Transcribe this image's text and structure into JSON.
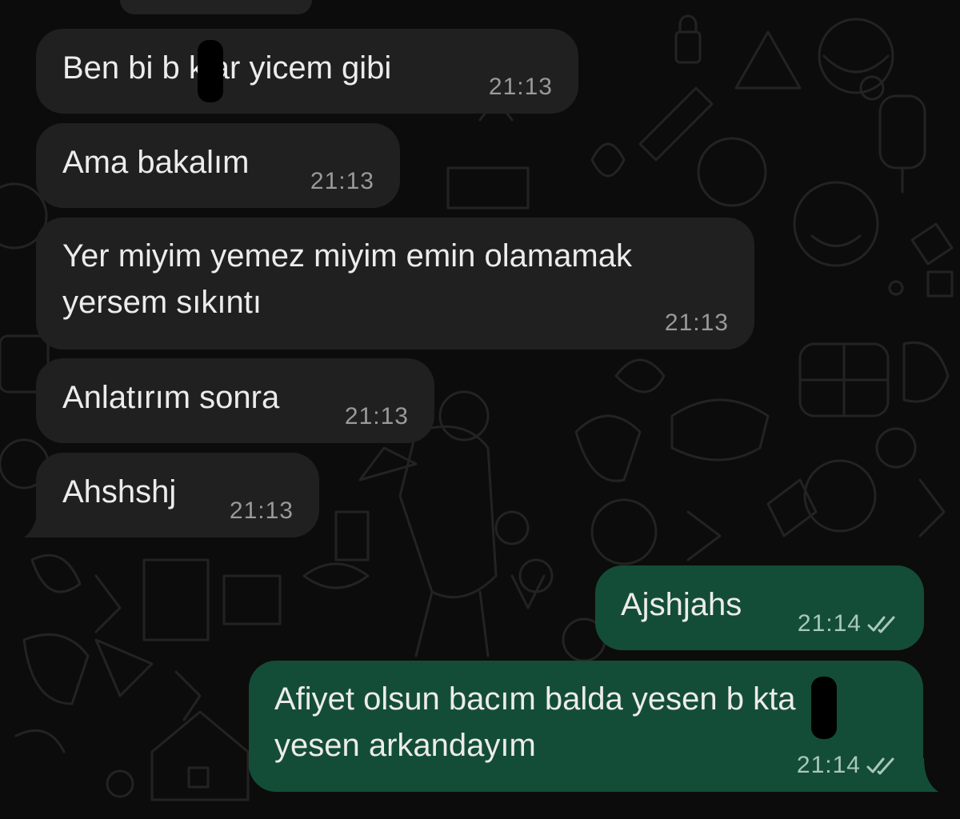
{
  "chat": {
    "messages": [
      {
        "direction": "incoming",
        "text": "Ben bi b  klar yicem gibi",
        "time": "21:13"
      },
      {
        "direction": "incoming",
        "text": "Ama bakalım",
        "time": "21:13"
      },
      {
        "direction": "incoming",
        "lines": [
          "Yer miyim yemez miyim emin olamamak",
          "yersem sıkıntı"
        ],
        "time": "21:13"
      },
      {
        "direction": "incoming",
        "text": "Anlatırım sonra",
        "time": "21:13"
      },
      {
        "direction": "incoming",
        "text": "Ahshshj",
        "time": "21:13"
      },
      {
        "direction": "outgoing",
        "text": "Ajshjahs",
        "time": "21:14",
        "status": "read"
      },
      {
        "direction": "outgoing",
        "lines": [
          "Afiyet olsun bacım balda yesen b  kta",
          "yesen arkandayım"
        ],
        "time": "21:14",
        "status": "read"
      }
    ]
  },
  "colors": {
    "background": "#0c0c0c",
    "incoming_bubble": "#202020",
    "outgoing_bubble": "#144d37",
    "message_text": "#ececec",
    "timestamp_text": "#9a9a9a"
  },
  "icons": {
    "read_receipt": "double-check-icon",
    "wallpaper": "doodle-pattern"
  }
}
